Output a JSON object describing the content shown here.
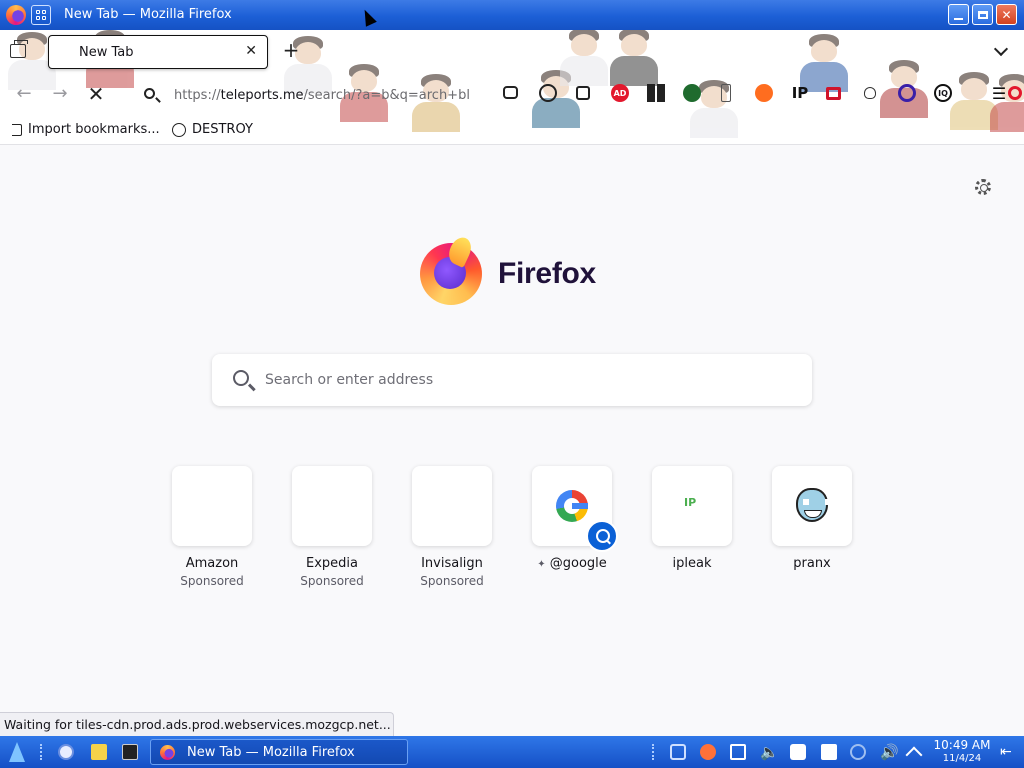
{
  "window": {
    "title": "New Tab — Mozilla Firefox",
    "controls": {
      "minimize": "",
      "maximize": "",
      "close": "✕"
    }
  },
  "tabs": [
    {
      "label": "New Tab",
      "close": "✕"
    }
  ],
  "tabstrip": {
    "new_tab": "+"
  },
  "navbar": {
    "back": "←",
    "forward": "→",
    "stop": "✕",
    "url_prefix": "https://",
    "url_host": "teleports.me",
    "url_rest": "/search/?a=b&q=arch+bl",
    "extensions": [
      "pocket-icon",
      "account-icon",
      "extensions-icon",
      "adblock-icon",
      "grid-icon",
      "vpn-icon",
      "phone-icon",
      "orange-icon",
      "IP",
      "red-box-icon",
      "bug-icon",
      "ring-icon",
      "iq-icon",
      "menu-icon",
      "browser-icon"
    ],
    "ext_ip_label": "IP",
    "ext_iq_label": "IQ"
  },
  "bookmarks": [
    {
      "label": "Import bookmarks...",
      "icon": "import-icon"
    },
    {
      "label": "DESTROY",
      "icon": "globe-icon"
    }
  ],
  "newtab": {
    "brand": "Firefox",
    "search_placeholder": "Search or enter address",
    "shortcuts": [
      {
        "title": "Amazon",
        "sponsor": "Sponsored"
      },
      {
        "title": "Expedia",
        "sponsor": "Sponsored"
      },
      {
        "title": "Invisalign",
        "sponsor": "Sponsored"
      },
      {
        "title": "@google",
        "prefix": "✦",
        "sponsor": ""
      },
      {
        "title": "ipleak",
        "sponsor": "",
        "icon_text": "IP"
      },
      {
        "title": "pranx",
        "sponsor": ""
      }
    ]
  },
  "status_text": "Waiting for tiles-cdn.prod.ads.prod.webservices.mozgcp.net...",
  "taskbar": {
    "task_label": "New Tab — Mozilla Firefox",
    "time": "10:49 AM",
    "date": "11/4/24"
  },
  "colors": {
    "titlebar": "#1c5fd6",
    "taskbar": "#1550c6",
    "firefox_purple": "#20123a",
    "search_badge": "#0b61d6"
  }
}
